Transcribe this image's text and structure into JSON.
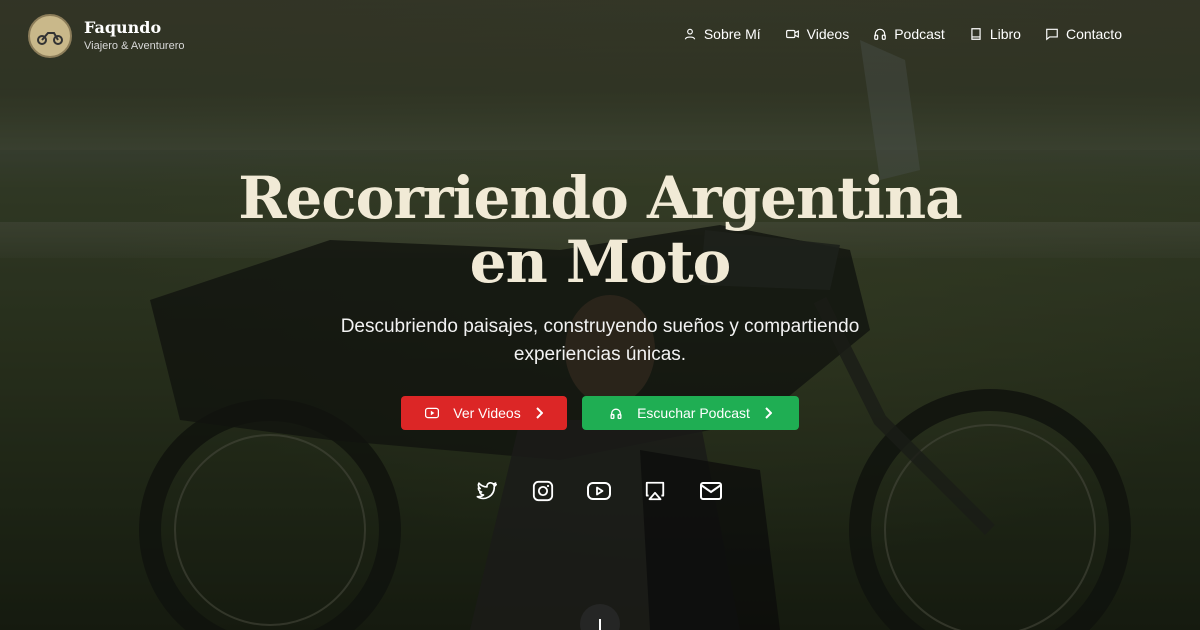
{
  "brand": {
    "name": "Faqundo",
    "tagline": "Viajero & Aventurero"
  },
  "nav": [
    {
      "label": "Sobre Mí",
      "icon": "user-icon"
    },
    {
      "label": "Videos",
      "icon": "video-icon"
    },
    {
      "label": "Podcast",
      "icon": "headphones-icon"
    },
    {
      "label": "Libro",
      "icon": "book-icon"
    },
    {
      "label": "Contacto",
      "icon": "message-icon"
    }
  ],
  "hero": {
    "title": "Recorriendo Argentina en Moto",
    "subtitle": "Descubriendo paisajes, construyendo sueños y compartiendo experiencias únicas.",
    "primary_button": "Ver Videos",
    "secondary_button": "Escuchar Podcast"
  },
  "social": [
    "twitter-icon",
    "instagram-icon",
    "youtube-icon",
    "airplay-icon",
    "mail-icon"
  ],
  "colors": {
    "primary": "#dc2626",
    "secondary": "#1fae53",
    "title": "#f1ead6"
  }
}
